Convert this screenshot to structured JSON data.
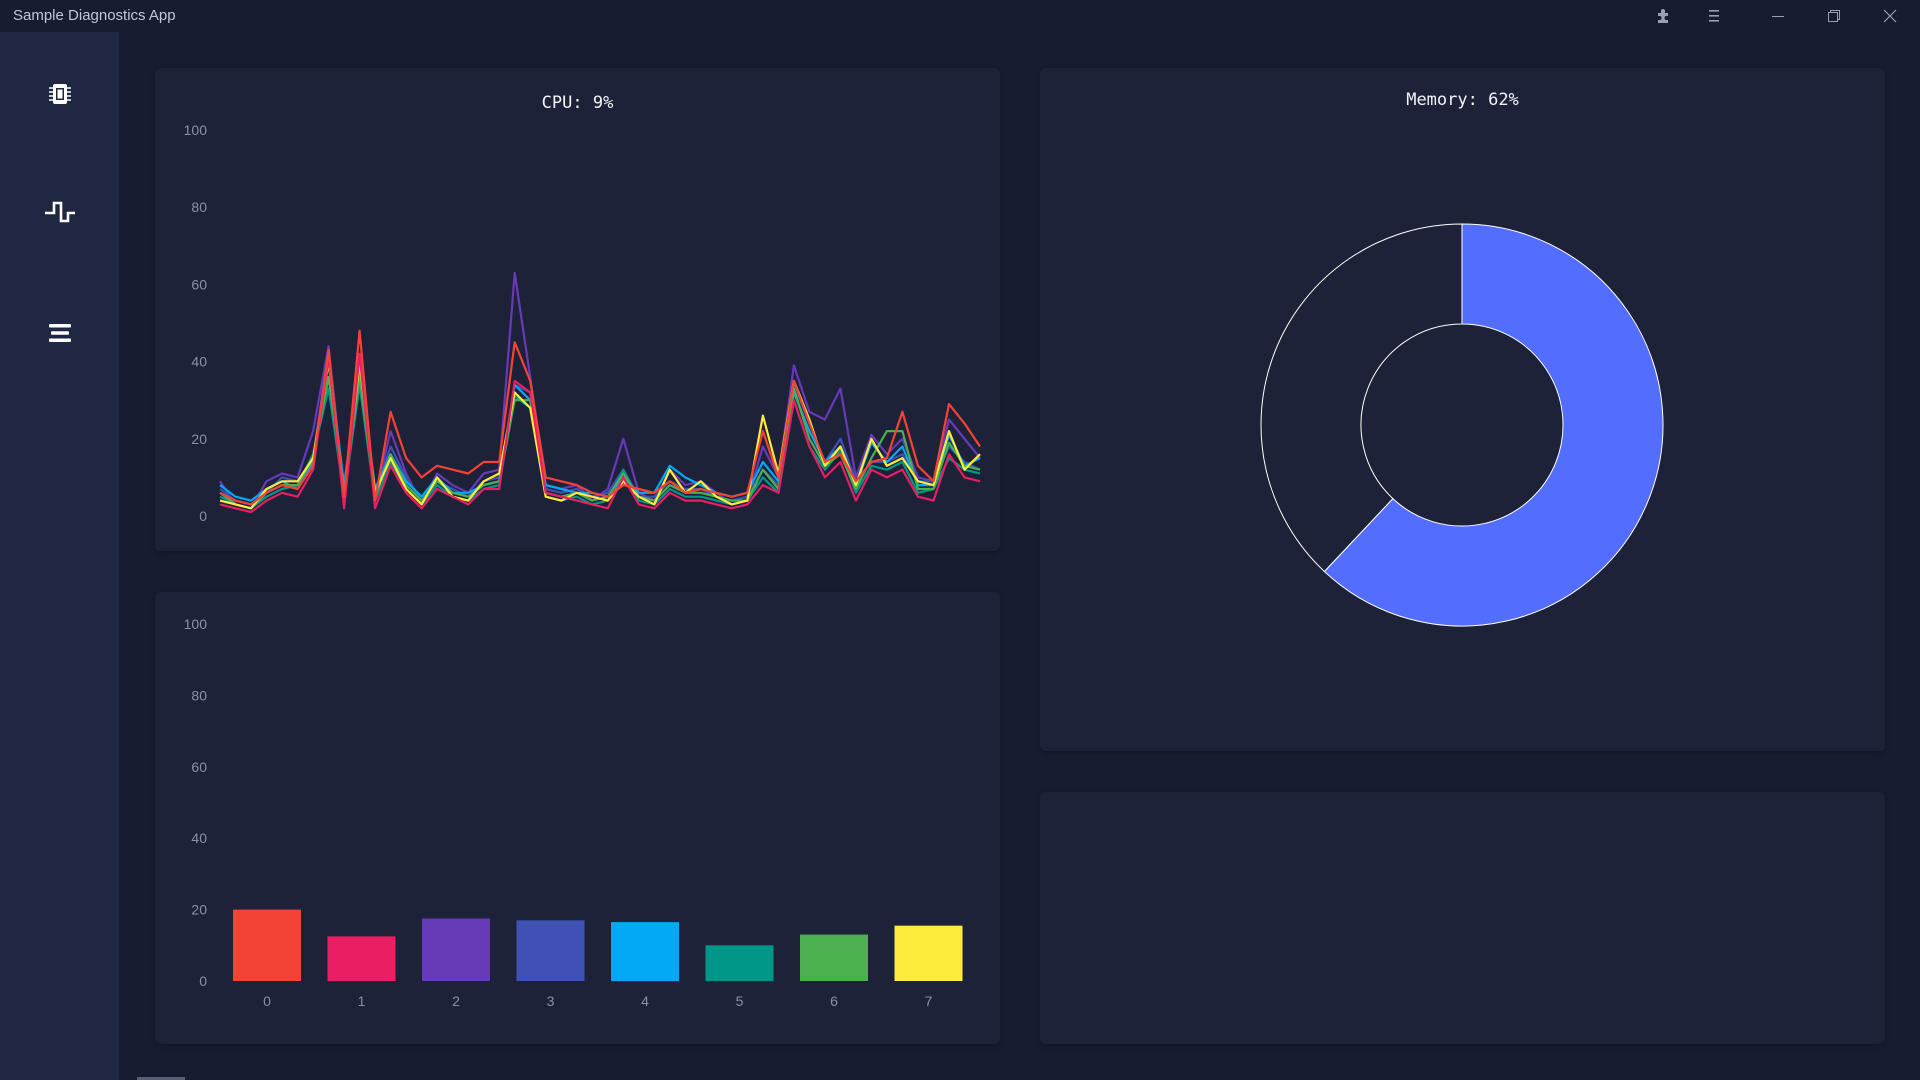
{
  "app": {
    "title": "Sample Diagnostics App"
  },
  "titlebar_icons": [
    "puzzle-icon",
    "menu-icon",
    "minimize-icon",
    "restore-icon",
    "close-icon"
  ],
  "sidebar": {
    "items": [
      {
        "name": "cpu",
        "icon": "chip-icon"
      },
      {
        "name": "activity",
        "icon": "pulse-icon"
      },
      {
        "name": "menu",
        "icon": "hamburger-icon"
      }
    ]
  },
  "cpu": {
    "title": "CPU: 9%"
  },
  "memory": {
    "title": "Memory: 62%"
  },
  "colors": {
    "background": "#171c30",
    "sidebar": "#202743",
    "card": "#1d2239",
    "memory_used": "#536dfe",
    "memory_free": "#1d2239"
  },
  "chart_data": [
    {
      "type": "line",
      "title": "CPU: 9%",
      "ylim": [
        0,
        100
      ],
      "yticks": [
        "100",
        "80",
        "60",
        "40",
        "20",
        "0"
      ],
      "series": [
        {
          "color": "#673ab7",
          "values": [
            9,
            3,
            2,
            9,
            11,
            10,
            22,
            44,
            6,
            42,
            5,
            22,
            11,
            3,
            11,
            8,
            6,
            11,
            12,
            63,
            36,
            8,
            7,
            8,
            4,
            7,
            20,
            6,
            4,
            12,
            8,
            9,
            6,
            3,
            4,
            18,
            10,
            39,
            27,
            25,
            33,
            10,
            21,
            16,
            20,
            10,
            9,
            25,
            20,
            15
          ]
        },
        {
          "color": "#3f51b5",
          "values": [
            7,
            4,
            3,
            6,
            10,
            9,
            15,
            43,
            7,
            41,
            6,
            18,
            10,
            4,
            9,
            7,
            5,
            9,
            10,
            34,
            32,
            7,
            6,
            7,
            5,
            6,
            12,
            5,
            5,
            9,
            7,
            7,
            5,
            4,
            5,
            12,
            8,
            34,
            24,
            14,
            20,
            9,
            14,
            14,
            16,
            9,
            9,
            18,
            14,
            12
          ]
        },
        {
          "color": "#03a9f4",
          "values": [
            8,
            5,
            4,
            7,
            9,
            7,
            14,
            40,
            8,
            38,
            7,
            16,
            9,
            5,
            10,
            6,
            6,
            8,
            9,
            34,
            30,
            8,
            7,
            6,
            6,
            5,
            10,
            6,
            6,
            13,
            10,
            8,
            6,
            5,
            6,
            14,
            9,
            32,
            22,
            14,
            18,
            8,
            19,
            14,
            18,
            8,
            8,
            21,
            13,
            15
          ]
        },
        {
          "color": "#009688",
          "values": [
            5,
            3,
            2,
            5,
            7,
            8,
            16,
            33,
            5,
            34,
            4,
            14,
            7,
            3,
            8,
            5,
            4,
            7,
            8,
            31,
            28,
            5,
            4,
            5,
            3,
            4,
            12,
            4,
            3,
            7,
            5,
            5,
            4,
            3,
            4,
            10,
            6,
            30,
            18,
            12,
            17,
            6,
            13,
            12,
            14,
            6,
            7,
            15,
            12,
            11
          ]
        },
        {
          "color": "#4caf50",
          "values": [
            6,
            3,
            2,
            6,
            8,
            8,
            15,
            36,
            6,
            36,
            5,
            16,
            8,
            4,
            9,
            6,
            5,
            8,
            9,
            30,
            30,
            6,
            5,
            6,
            4,
            5,
            11,
            5,
            4,
            8,
            6,
            6,
            5,
            4,
            4,
            12,
            7,
            33,
            20,
            13,
            16,
            7,
            15,
            22,
            22,
            7,
            7,
            19,
            13,
            12
          ]
        },
        {
          "color": "#ffeb3b",
          "values": [
            4,
            3,
            2,
            7,
            9,
            9,
            15,
            40,
            5,
            40,
            6,
            15,
            7,
            3,
            10,
            5,
            4,
            9,
            11,
            32,
            28,
            5,
            4,
            6,
            5,
            4,
            9,
            5,
            3,
            12,
            6,
            9,
            5,
            3,
            4,
            26,
            11,
            35,
            25,
            13,
            18,
            8,
            20,
            13,
            15,
            9,
            8,
            22,
            12,
            16
          ]
        },
        {
          "color": "#e91e63",
          "values": [
            3,
            2,
            1,
            4,
            6,
            5,
            12,
            41,
            2,
            42,
            2,
            13,
            6,
            2,
            7,
            5,
            3,
            7,
            7,
            35,
            32,
            6,
            5,
            4,
            3,
            2,
            10,
            3,
            2,
            6,
            4,
            4,
            3,
            2,
            3,
            8,
            6,
            30,
            18,
            10,
            14,
            4,
            12,
            10,
            12,
            5,
            4,
            16,
            10,
            9
          ]
        },
        {
          "color": "#f44336",
          "values": [
            6,
            4,
            3,
            6,
            8,
            7,
            13,
            43,
            5,
            48,
            4,
            27,
            15,
            10,
            13,
            12,
            11,
            14,
            14,
            45,
            35,
            10,
            9,
            8,
            6,
            5,
            8,
            7,
            6,
            9,
            6,
            7,
            6,
            5,
            6,
            22,
            10,
            35,
            24,
            14,
            16,
            9,
            14,
            15,
            27,
            13,
            9,
            29,
            24,
            18
          ]
        }
      ]
    },
    {
      "type": "bar",
      "categories": [
        "0",
        "1",
        "2",
        "3",
        "4",
        "5",
        "6",
        "7"
      ],
      "values": [
        20,
        12.5,
        17.5,
        17,
        16.5,
        10,
        13,
        15.5
      ],
      "colors": [
        "#f44336",
        "#e91e63",
        "#673ab7",
        "#3f51b5",
        "#03a9f4",
        "#009688",
        "#4caf50",
        "#ffeb3b"
      ],
      "ylim": [
        0,
        100
      ],
      "yticks": [
        "100",
        "80",
        "60",
        "40",
        "20",
        "0"
      ]
    },
    {
      "type": "pie",
      "title": "Memory: 62%",
      "values": [
        62,
        38
      ],
      "colors": [
        "#536dfe",
        "#1d2239"
      ]
    }
  ]
}
